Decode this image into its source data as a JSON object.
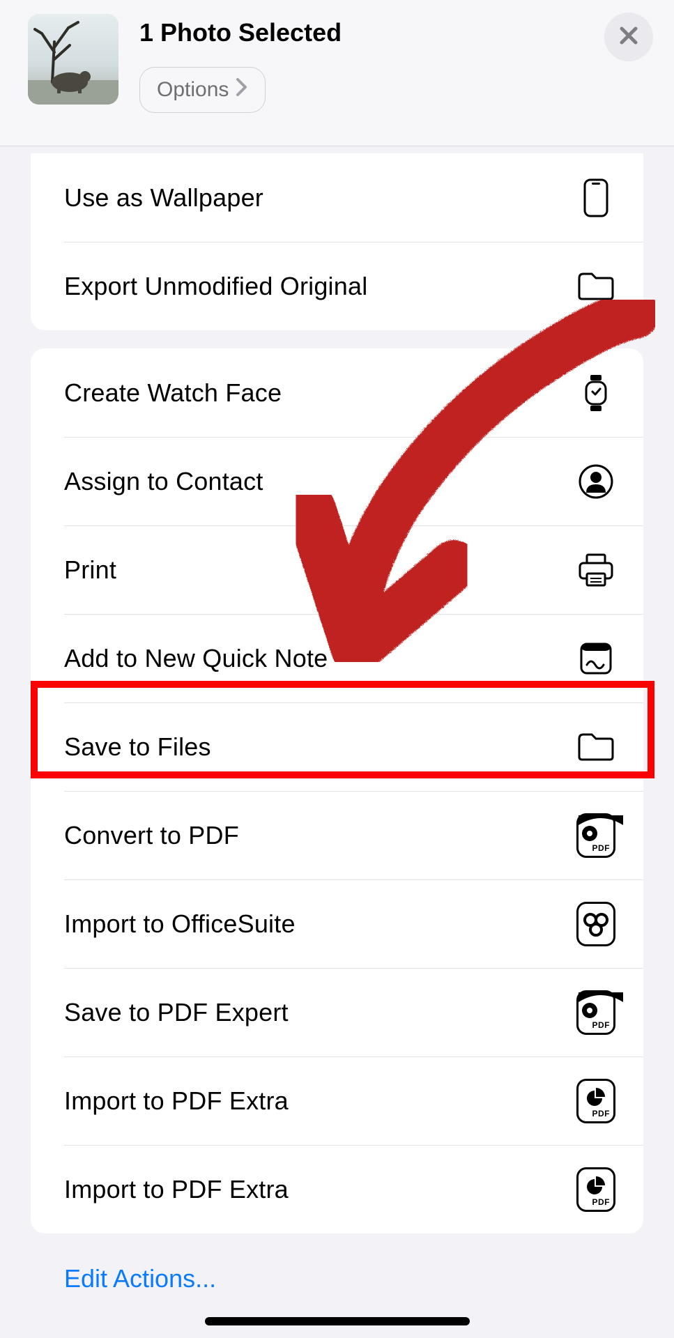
{
  "header": {
    "title": "1 Photo Selected",
    "options_label": "Options"
  },
  "groups": [
    {
      "items": [
        {
          "label": "Use as Wallpaper",
          "icon": "phone"
        },
        {
          "label": "Export Unmodified Original",
          "icon": "folder"
        }
      ]
    },
    {
      "items": [
        {
          "label": "Create Watch Face",
          "icon": "watch"
        },
        {
          "label": "Assign to Contact",
          "icon": "contact"
        },
        {
          "label": "Print",
          "icon": "printer"
        },
        {
          "label": "Add to New Quick Note",
          "icon": "quicknote"
        },
        {
          "label": "Save to Files",
          "icon": "folder",
          "highlighted": true
        },
        {
          "label": "Convert to PDF",
          "icon": "pdfexpert"
        },
        {
          "label": "Import to OfficeSuite",
          "icon": "officesuite"
        },
        {
          "label": "Save to PDF Expert",
          "icon": "pdfexpert"
        },
        {
          "label": "Import to PDF Extra",
          "icon": "pdfextra"
        },
        {
          "label": "Import to PDF Extra",
          "icon": "pdfextra"
        }
      ]
    }
  ],
  "footer": {
    "edit_actions": "Edit Actions..."
  },
  "annotation": {
    "arrow_color": "#c02222",
    "highlight_color": "#ff0000",
    "highlight_target": "Save to Files"
  }
}
